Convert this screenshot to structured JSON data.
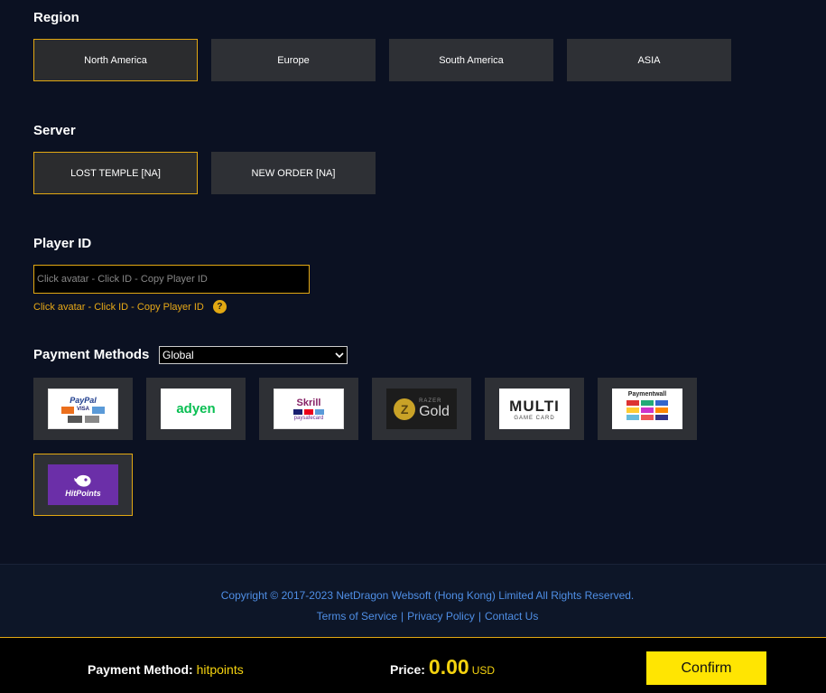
{
  "region": {
    "title": "Region",
    "options": [
      "North America",
      "Europe",
      "South America",
      "ASIA"
    ],
    "selected": "North America"
  },
  "server": {
    "title": "Server",
    "options": [
      "LOST TEMPLE [NA]",
      "NEW ORDER [NA]"
    ],
    "selected": "LOST TEMPLE [NA]"
  },
  "player_id": {
    "title": "Player ID",
    "placeholder": "Click avatar - Click ID - Copy Player ID",
    "value": "",
    "hint": "Click avatar - Click ID - Copy Player ID",
    "help_icon": "?"
  },
  "payment": {
    "title": "Payment Methods",
    "select_value": "Global",
    "methods": [
      {
        "name": "PayPal",
        "logo_text": "PayPal",
        "sub": "VISA"
      },
      {
        "name": "Adyen",
        "logo_text": "adyen"
      },
      {
        "name": "Skrill",
        "logo_text": "Skrill",
        "sub": "paysafecard"
      },
      {
        "name": "Razer Gold",
        "logo_text": "Gold",
        "sub": "RAZER"
      },
      {
        "name": "Multi Game Card",
        "logo_text": "MULTI",
        "sub": "GAME CARD"
      },
      {
        "name": "Paymentwall",
        "logo_text": "Paymentwall"
      },
      {
        "name": "HitPoints",
        "logo_text": "HitPoints"
      }
    ],
    "selected": "HitPoints"
  },
  "footer": {
    "copyright": "Copyright © 2017-2023 NetDragon Websoft (Hong Kong) Limited All Rights Reserved.",
    "links": [
      "Terms of Service",
      "Privacy Policy",
      "Contact Us"
    ]
  },
  "bar": {
    "payment_label": "Payment Method:",
    "payment_value": "hitpoints",
    "price_label": "Price:",
    "price_value": "0.00",
    "currency": "USD",
    "confirm_label": "Confirm"
  },
  "colors": {
    "accent": "#e2a812",
    "background": "#0b1122",
    "confirm": "#ffe502",
    "link": "#4f8fe6"
  }
}
